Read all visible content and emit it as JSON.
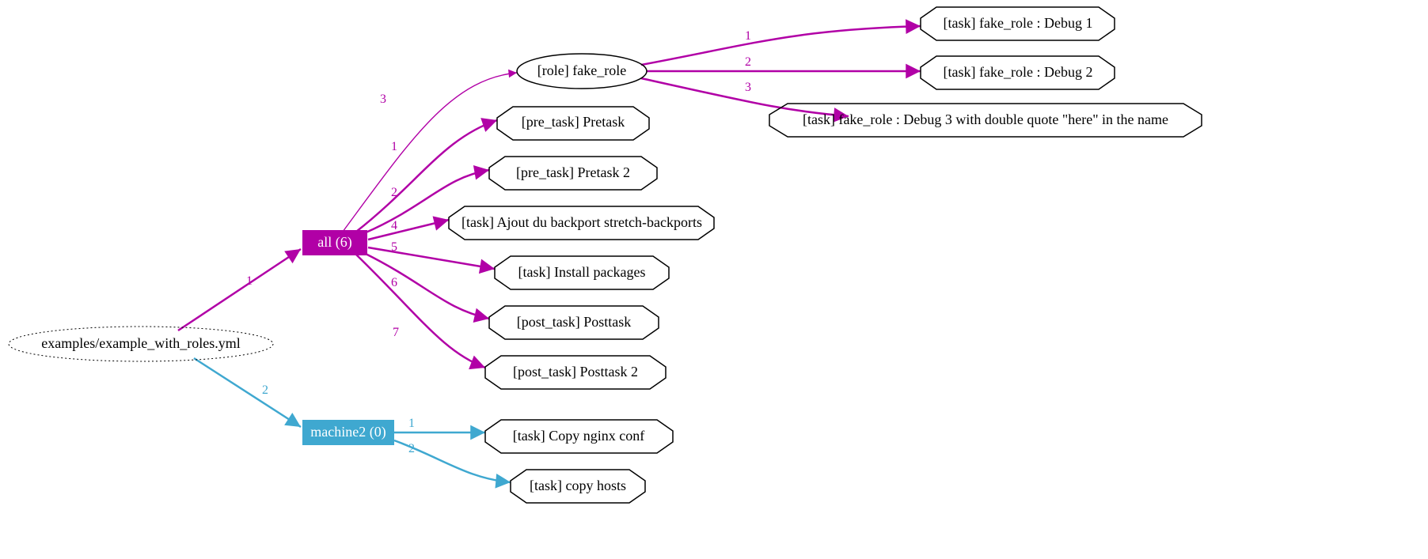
{
  "colors": {
    "magenta": "#b100a6",
    "cyan": "#3fa8d0",
    "black": "#000000",
    "white": "#ffffff"
  },
  "root": {
    "label": "examples/example_with_roles.yml"
  },
  "plays": {
    "all": {
      "label": "all (6)"
    },
    "machine2": {
      "label": "machine2 (0)"
    }
  },
  "role": {
    "label": "[role] fake_role"
  },
  "tasks": {
    "pretask1": "[pre_task] Pretask",
    "pretask2": "[pre_task] Pretask 2",
    "backport": "[task] Ajout du backport stretch-backports",
    "install": "[task] Install packages",
    "posttask1": "[post_task] Posttask",
    "posttask2": "[post_task] Posttask 2",
    "nginx": "[task] Copy nginx conf",
    "hosts": "[task] copy hosts",
    "debug1": "[task] fake_role : Debug 1",
    "debug2": "[task] fake_role : Debug 2",
    "debug3": "[task] fake_role : Debug 3 with double quote \"here\" in the name"
  },
  "edges": {
    "root_all": "1",
    "root_machine2": "2",
    "all_pretask1": "1",
    "all_pretask2": "2",
    "all_role": "3",
    "all_backport": "4",
    "all_install": "5",
    "all_posttask1": "6",
    "all_posttask2": "7",
    "machine2_nginx": "1",
    "machine2_hosts": "2",
    "role_debug1": "1",
    "role_debug2": "2",
    "role_debug3": "3"
  }
}
